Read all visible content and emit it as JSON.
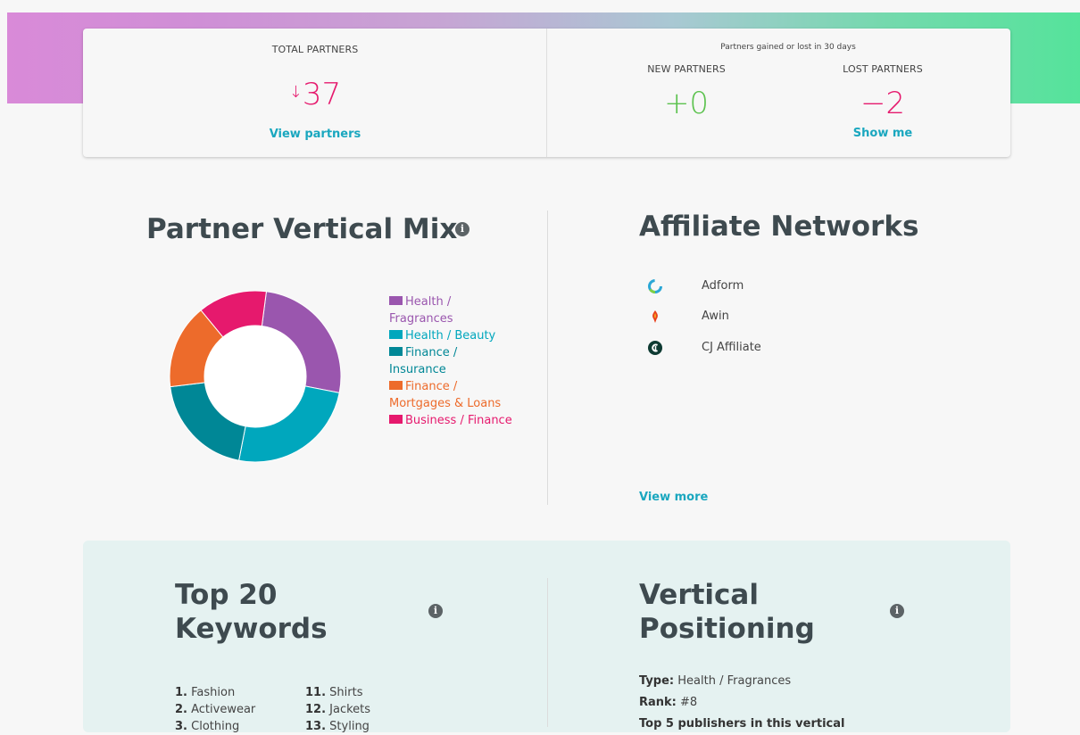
{
  "stats": {
    "total_label": "TOTAL PARTNERS",
    "total_arrow": "↓",
    "total_value": "37",
    "total_link": "View partners",
    "period_caption": "Partners gained or lost in 30 days",
    "new_label": "NEW PARTNERS",
    "new_value": "+0",
    "lost_label": "LOST PARTNERS",
    "lost_value": "−2",
    "lost_link": "Show me"
  },
  "vertical_mix": {
    "title": "Partner Vertical Mix",
    "legend": [
      {
        "label": "Health / Fragrances",
        "color": "#9a56ae",
        "share": 0.26
      },
      {
        "label": "Health / Beauty",
        "color": "#00a7bd",
        "share": 0.25
      },
      {
        "label": "Finance / Insurance",
        "color": "#008796",
        "share": 0.2
      },
      {
        "label": "Finance / Mortgages & Loans",
        "color": "#ed6b2b",
        "share": 0.16
      },
      {
        "label": "Business / Finance",
        "color": "#e6196d",
        "share": 0.13
      }
    ]
  },
  "networks": {
    "title": "Affiliate Networks",
    "items": [
      {
        "name": "Adform",
        "icon": "adform-ring-icon"
      },
      {
        "name": "Awin",
        "icon": "awin-flame-icon"
      },
      {
        "name": "CJ Affiliate",
        "icon": "cj-affiliate-icon"
      }
    ],
    "view_more": "View more"
  },
  "keywords": {
    "title_line1": "Top 20",
    "title_line2": "Keywords",
    "col1": [
      {
        "rank": "1.",
        "word": "Fashion"
      },
      {
        "rank": "2.",
        "word": "Activewear"
      },
      {
        "rank": "3.",
        "word": "Clothing"
      }
    ],
    "col2": [
      {
        "rank": "11.",
        "word": "Shirts"
      },
      {
        "rank": "12.",
        "word": "Jackets"
      },
      {
        "rank": "13.",
        "word": "Styling"
      }
    ]
  },
  "positioning": {
    "title_line1": "Vertical",
    "title_line2": "Positioning",
    "type_label": "Type:",
    "type_value": "Health / Fragrances",
    "rank_label": "Rank:",
    "rank_value": "#8",
    "top_pubs_label": "Top 5 publishers in this vertical"
  },
  "colors": {
    "accent_link": "#1aa7bf",
    "negative": "#e6196d",
    "positive": "#5cc24e"
  }
}
